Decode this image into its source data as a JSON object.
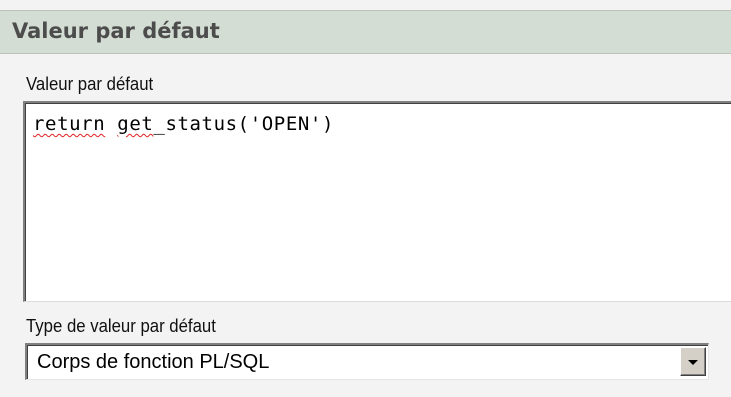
{
  "section": {
    "title": "Valeur par défaut"
  },
  "default_value": {
    "label": "Valeur par défaut",
    "code_tokens": [
      "return",
      " ",
      "get",
      "_status('OPEN')"
    ]
  },
  "default_type": {
    "label": "Type de valeur par défaut",
    "selected": "Corps de fonction PL/SQL"
  },
  "icons": {
    "dropdown": "chevron-down-icon"
  }
}
